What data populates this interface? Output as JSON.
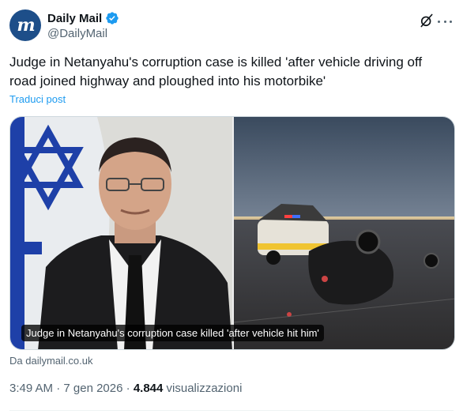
{
  "account": {
    "display_name": "Daily Mail",
    "handle": "@DailyMail",
    "avatar_letter": "m",
    "verified": true
  },
  "tweet": {
    "text": "Judge in Netanyahu's corruption case is killed 'after vehicle driving off road joined highway and ploughed into his motorbike'",
    "translate_label": "Traduci post"
  },
  "card": {
    "caption": "Judge in Netanyahu's corruption case killed 'after vehicle hit him'",
    "source": "Da dailymail.co.uk"
  },
  "meta": {
    "time": "3:49 AM",
    "separator": "·",
    "date": "7 gen 2026",
    "views_count": "4.844",
    "views_label": "visualizzazioni"
  },
  "colors": {
    "accent": "#1d9bf0",
    "avatar_bg": "#1d4e89",
    "secondary_text": "#536471"
  },
  "icons": [
    "verified-badge-icon",
    "grok-icon",
    "more-icon"
  ]
}
